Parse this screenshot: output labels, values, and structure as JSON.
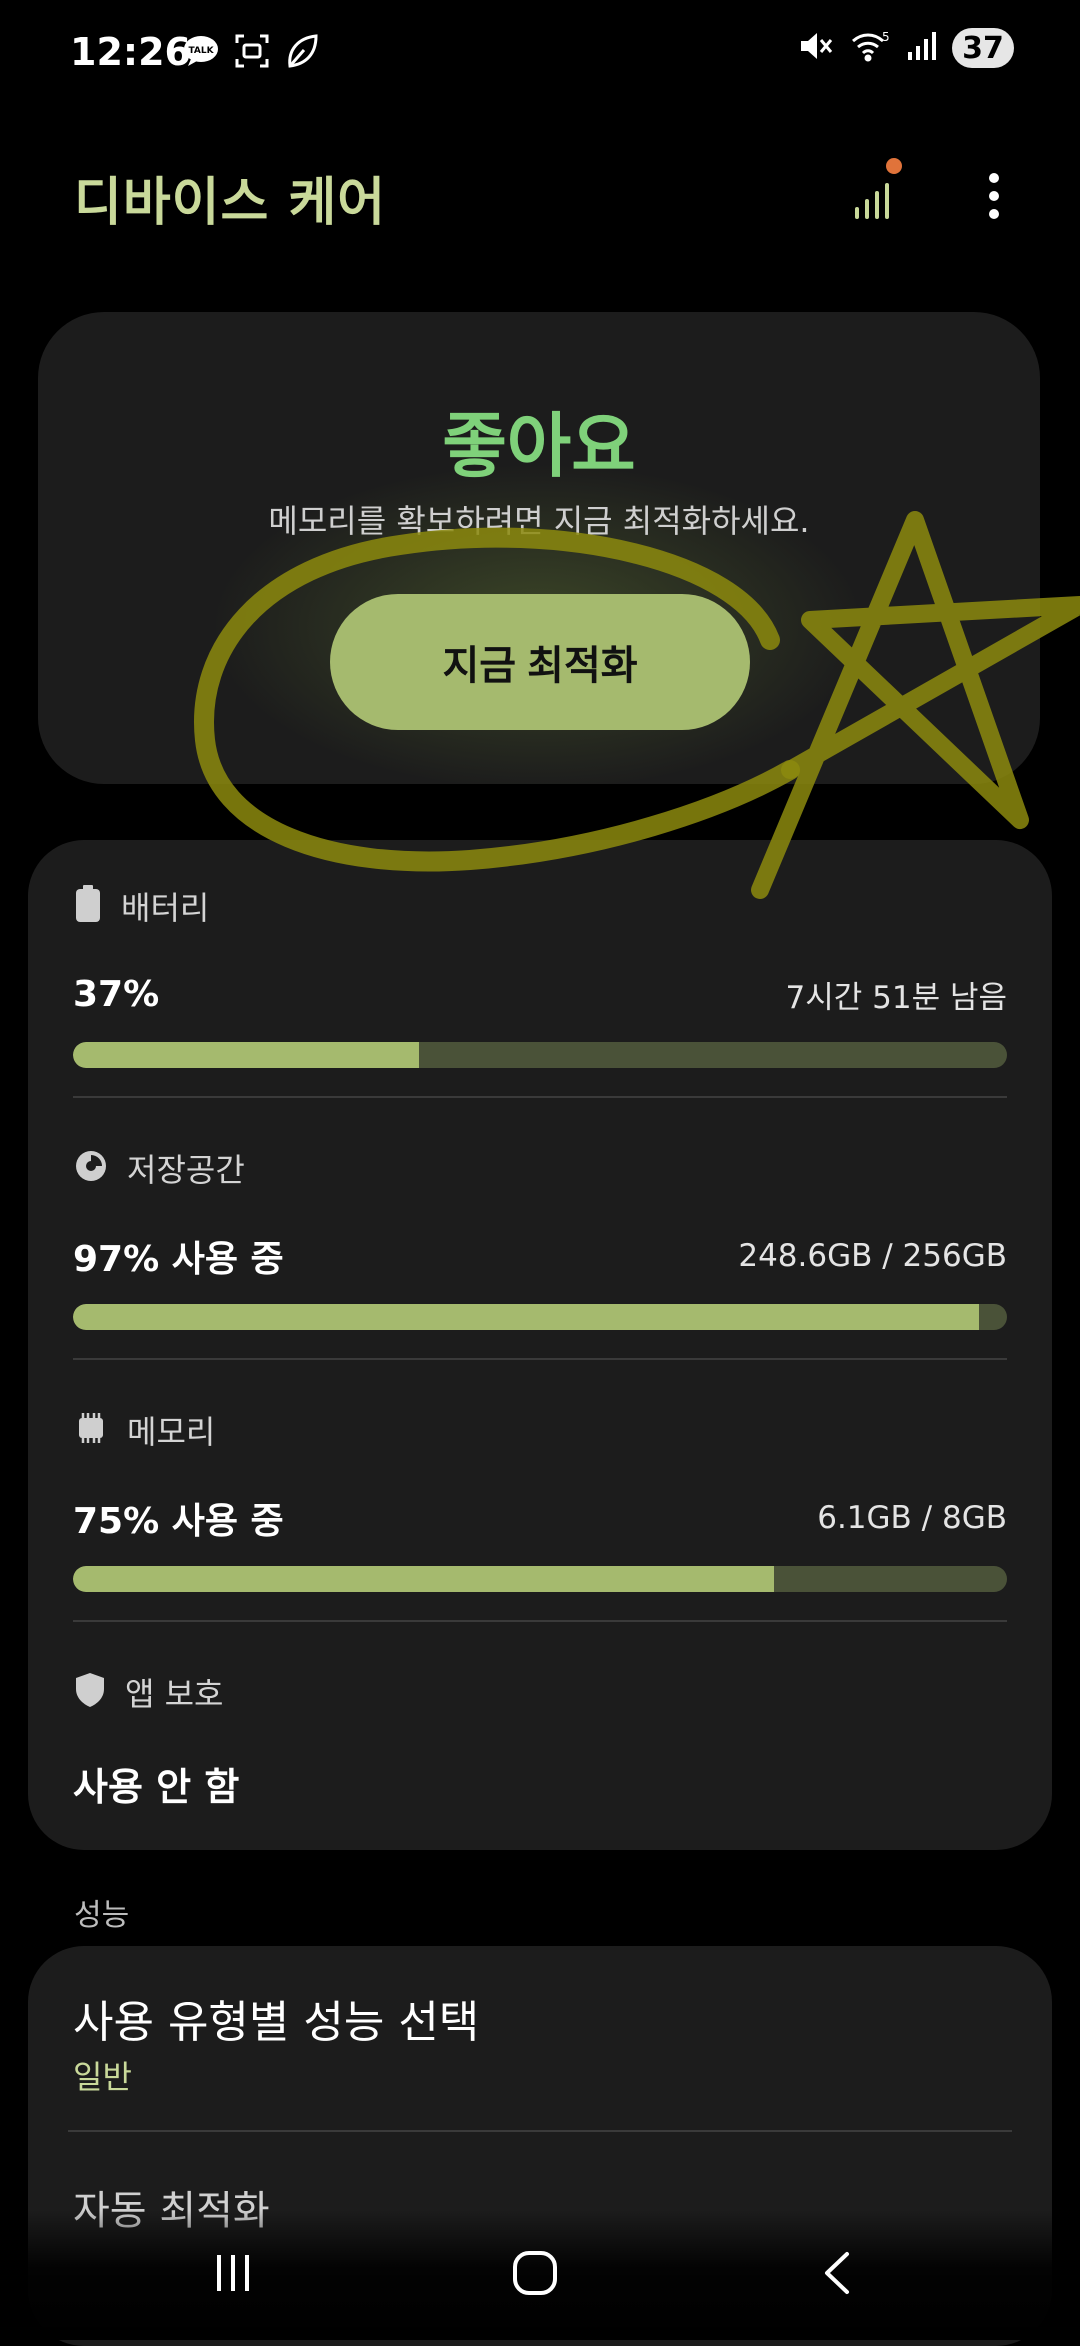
{
  "status_bar": {
    "time": "12:26",
    "battery_level": "37",
    "left_icons": [
      "kakaotalk-icon",
      "screenshot-icon",
      "leaf-icon"
    ],
    "right_icons": [
      "mute-icon",
      "wifi-icon",
      "signal-icon"
    ]
  },
  "header": {
    "title": "디바이스 케어",
    "actions": [
      "signal-chart-icon",
      "more-options-icon"
    ]
  },
  "status_card": {
    "headline": "좋아요",
    "subtitle": "메모리를 확보하려면 지금 최적화하세요.",
    "button_label": "지금 최적화"
  },
  "resources": {
    "battery": {
      "label": "배터리",
      "value": "37%",
      "detail": "7시간 51분 남음",
      "level_percent": 37
    },
    "storage": {
      "label": "저장공간",
      "value": "97% 사용 중",
      "detail": "248.6GB / 256GB",
      "level_percent": 97
    },
    "memory": {
      "label": "메모리",
      "value": "75% 사용 중",
      "detail": "6.1GB / 8GB",
      "level_percent": 75
    },
    "app_protection": {
      "label": "앱 보호",
      "value": "사용 안 함"
    }
  },
  "performance": {
    "section_label": "성능",
    "items": [
      {
        "title": "사용 유형별 성능 선택",
        "subtitle": "일반"
      },
      {
        "title": "자동 최적화"
      }
    ]
  },
  "navigation": [
    "recent-apps-icon",
    "home-icon",
    "back-icon"
  ],
  "colors": {
    "accent": "#a5ba6e",
    "title": "#c9d99a",
    "good_status": "#7fd17a",
    "card": "#1c1c1c",
    "bar_track": "#4a5238",
    "annotation": "#8a8a10"
  }
}
